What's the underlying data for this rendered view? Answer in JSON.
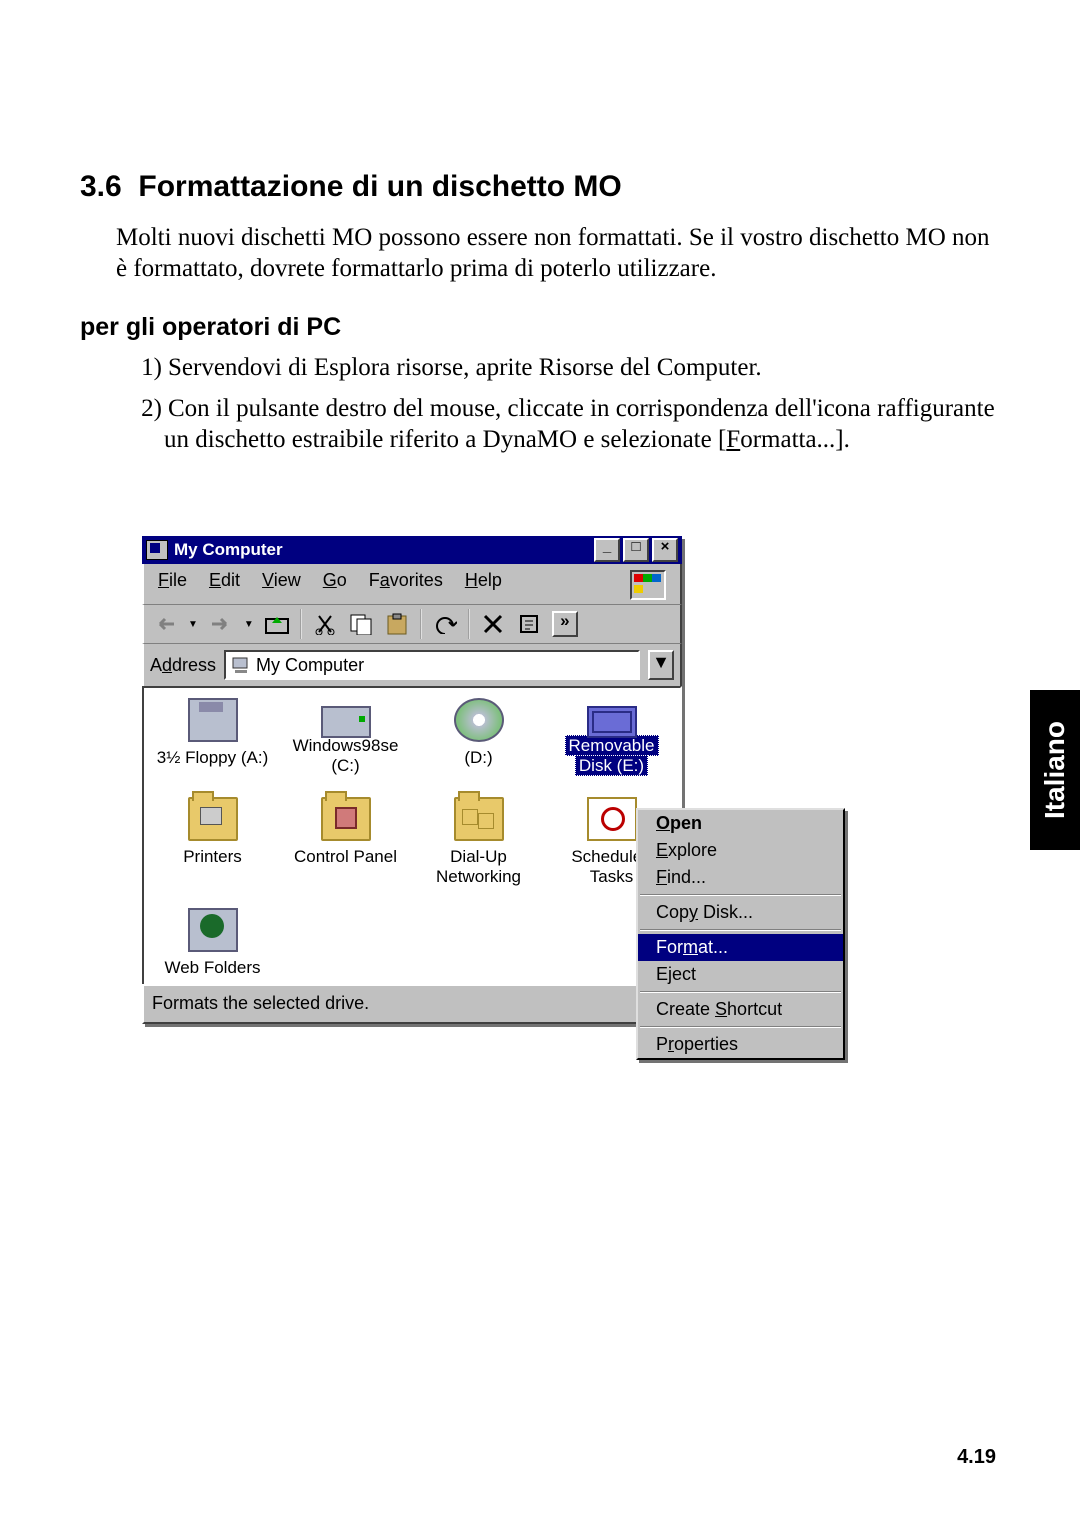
{
  "section": {
    "number": "3.6",
    "title": "Formattazione di un dischetto MO",
    "intro": "Molti nuovi dischetti MO possono essere non formattati. Se il vostro dischetto MO non è formattato, dovrete formattarlo prima di poterlo utilizzare.",
    "subheading": "per gli operatori di PC",
    "step1": "Servendovi di Esplora risorse, aprite Risorse del Computer.",
    "step2_a": "Con il pulsante destro del mouse, cliccate in corrispondenza dell'icona raffigurante un dischetto estraibile riferito a DynaMO e selezionate [",
    "step2_fmt_char": "F",
    "step2_b": "ormatta...]."
  },
  "sideTab": "Italiano",
  "pageNumber": "4.19",
  "window": {
    "title": "My Computer",
    "menus": {
      "file": {
        "pre": "",
        "u": "F",
        "post": "ile"
      },
      "edit": {
        "pre": "",
        "u": "E",
        "post": "dit"
      },
      "view": {
        "pre": "",
        "u": "V",
        "post": "iew"
      },
      "go": {
        "pre": "",
        "u": "G",
        "post": "o"
      },
      "favorites": {
        "pre": "F",
        "u": "a",
        "post": "vorites"
      },
      "help": {
        "pre": "",
        "u": "H",
        "post": "elp"
      }
    },
    "address": {
      "pre": "A",
      "u": "d",
      "post": "dress"
    },
    "addressValue": "My Computer",
    "icons": {
      "floppy": "3½ Floppy (A:)",
      "hdd": "Windows98se (C:)",
      "cd": "(D:)",
      "removL1": "Removable",
      "removL2": "Disk (E:)",
      "printers": "Printers",
      "cpanel": "Control Panel",
      "dialupL1": "Dial-Up",
      "dialupL2": "Networking",
      "schedL1": "Scheduled",
      "schedL2": "Tasks",
      "web": "Web Folders"
    },
    "status": "Formats the selected drive."
  },
  "contextMenu": {
    "open": {
      "pre": "",
      "u": "O",
      "post": "pen"
    },
    "explore": {
      "pre": "",
      "u": "E",
      "post": "xplore"
    },
    "find": {
      "pre": "",
      "u": "F",
      "post": "ind..."
    },
    "copyDisk": {
      "pre": "Cop",
      "u": "y",
      "post": " Disk..."
    },
    "format": {
      "pre": "For",
      "u": "m",
      "post": "at..."
    },
    "eject": {
      "pre": "E",
      "u": "j",
      "post": "ect"
    },
    "shortcut": {
      "pre": "Create ",
      "u": "S",
      "post": "hortcut"
    },
    "properties": {
      "pre": "P",
      "u": "r",
      "post": "operties"
    }
  }
}
